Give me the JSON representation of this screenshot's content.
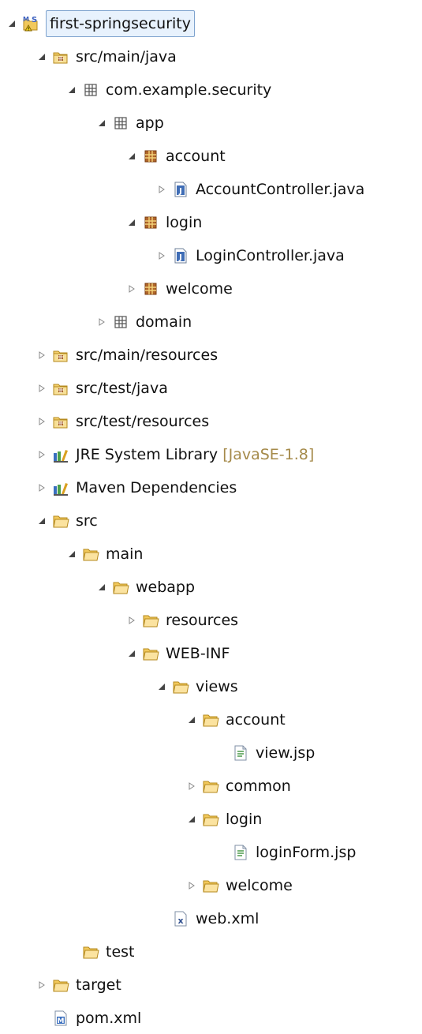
{
  "tree": [
    {
      "label": "first-springsecurity",
      "icon": "maven-project-icon",
      "state": "expanded",
      "depth": 0,
      "selected": true
    },
    {
      "label": "src/main/java",
      "icon": "source-folder-icon",
      "state": "expanded",
      "depth": 1
    },
    {
      "label": "com.example.security",
      "icon": "package-outline-icon",
      "state": "expanded",
      "depth": 2
    },
    {
      "label": "app",
      "icon": "package-outline-icon",
      "state": "expanded",
      "depth": 3
    },
    {
      "label": "account",
      "icon": "package-icon",
      "state": "expanded",
      "depth": 4
    },
    {
      "label": "AccountController.java",
      "icon": "java-file-icon",
      "state": "collapsed",
      "depth": 5
    },
    {
      "label": "login",
      "icon": "package-icon",
      "state": "expanded",
      "depth": 4
    },
    {
      "label": "LoginController.java",
      "icon": "java-file-icon",
      "state": "collapsed",
      "depth": 5
    },
    {
      "label": "welcome",
      "icon": "package-icon",
      "state": "collapsed",
      "depth": 4
    },
    {
      "label": "domain",
      "icon": "package-outline-icon",
      "state": "collapsed",
      "depth": 3
    },
    {
      "label": "src/main/resources",
      "icon": "source-folder-icon",
      "state": "collapsed",
      "depth": 1
    },
    {
      "label": "src/test/java",
      "icon": "source-folder-icon",
      "state": "collapsed",
      "depth": 1
    },
    {
      "label": "src/test/resources",
      "icon": "source-folder-icon",
      "state": "collapsed",
      "depth": 1
    },
    {
      "label": "JRE System Library",
      "decoration": "[JavaSE-1.8]",
      "icon": "library-icon",
      "state": "collapsed",
      "depth": 1
    },
    {
      "label": "Maven Dependencies",
      "icon": "library-icon",
      "state": "collapsed",
      "depth": 1
    },
    {
      "label": "src",
      "icon": "folder-icon",
      "state": "expanded",
      "depth": 1
    },
    {
      "label": "main",
      "icon": "folder-icon",
      "state": "expanded",
      "depth": 2
    },
    {
      "label": "webapp",
      "icon": "folder-icon",
      "state": "expanded",
      "depth": 3
    },
    {
      "label": "resources",
      "icon": "folder-icon",
      "state": "collapsed",
      "depth": 4
    },
    {
      "label": "WEB-INF",
      "icon": "folder-icon",
      "state": "expanded",
      "depth": 4
    },
    {
      "label": "views",
      "icon": "folder-icon",
      "state": "expanded",
      "depth": 5
    },
    {
      "label": "account",
      "icon": "folder-icon",
      "state": "expanded",
      "depth": 6
    },
    {
      "label": "view.jsp",
      "icon": "jsp-file-icon",
      "state": "leaf",
      "depth": 7
    },
    {
      "label": "common",
      "icon": "folder-icon",
      "state": "collapsed",
      "depth": 6
    },
    {
      "label": "login",
      "icon": "folder-icon",
      "state": "expanded",
      "depth": 6
    },
    {
      "label": "loginForm.jsp",
      "icon": "jsp-file-icon",
      "state": "leaf",
      "depth": 7
    },
    {
      "label": "welcome",
      "icon": "folder-icon",
      "state": "collapsed",
      "depth": 6
    },
    {
      "label": "web.xml",
      "icon": "xml-file-icon",
      "state": "leaf",
      "depth": 5
    },
    {
      "label": "test",
      "icon": "folder-icon",
      "state": "leaf",
      "depth": 2
    },
    {
      "label": "target",
      "icon": "folder-icon",
      "state": "collapsed",
      "depth": 1
    },
    {
      "label": "pom.xml",
      "icon": "maven-pom-icon",
      "state": "leaf",
      "depth": 1
    }
  ]
}
